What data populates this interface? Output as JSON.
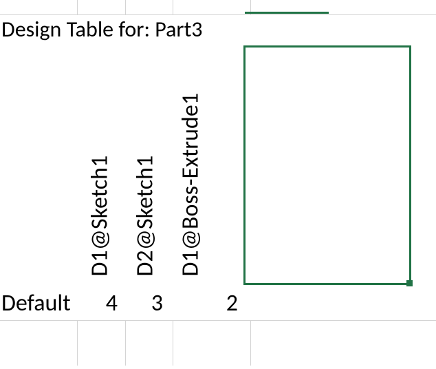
{
  "title": "Design Table for: Part3",
  "parameters": {
    "p1": "D1@Sketch1",
    "p2": "D2@Sketch1",
    "p3": "D1@Boss-Extrude1"
  },
  "config_name": "Default",
  "values": {
    "v1": "4",
    "v2": "3",
    "v3": "2"
  }
}
